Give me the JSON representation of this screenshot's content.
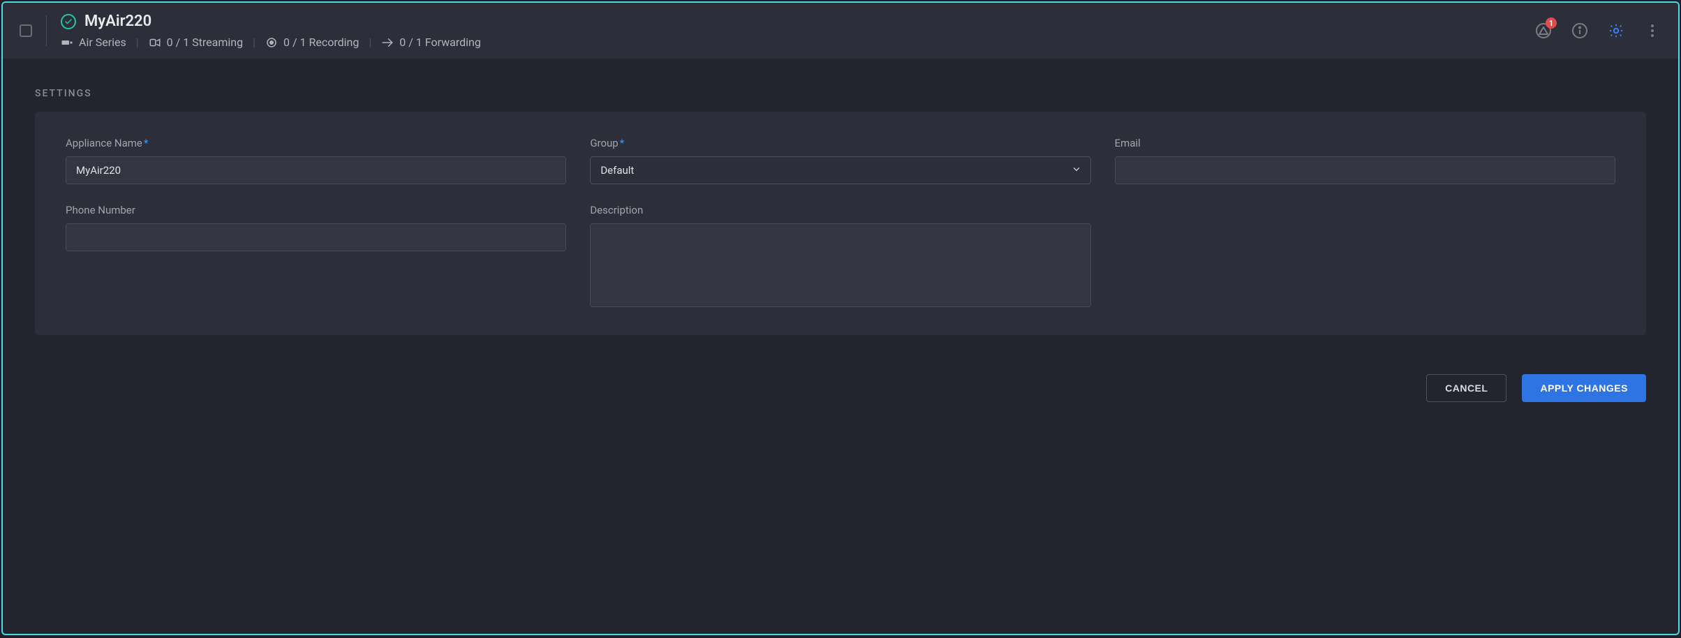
{
  "header": {
    "title": "MyAir220",
    "series_label": "Air Series",
    "streaming_label": "0 / 1 Streaming",
    "recording_label": "0 / 1 Recording",
    "forwarding_label": "0 / 1 Forwarding",
    "alert_badge": "1"
  },
  "section": {
    "title": "SETTINGS"
  },
  "form": {
    "appliance_name": {
      "label": "Appliance Name",
      "value": "MyAir220"
    },
    "group": {
      "label": "Group",
      "value": "Default"
    },
    "email": {
      "label": "Email",
      "value": ""
    },
    "phone": {
      "label": "Phone Number",
      "value": ""
    },
    "description": {
      "label": "Description",
      "value": ""
    }
  },
  "actions": {
    "cancel": "CANCEL",
    "apply": "APPLY CHANGES"
  }
}
